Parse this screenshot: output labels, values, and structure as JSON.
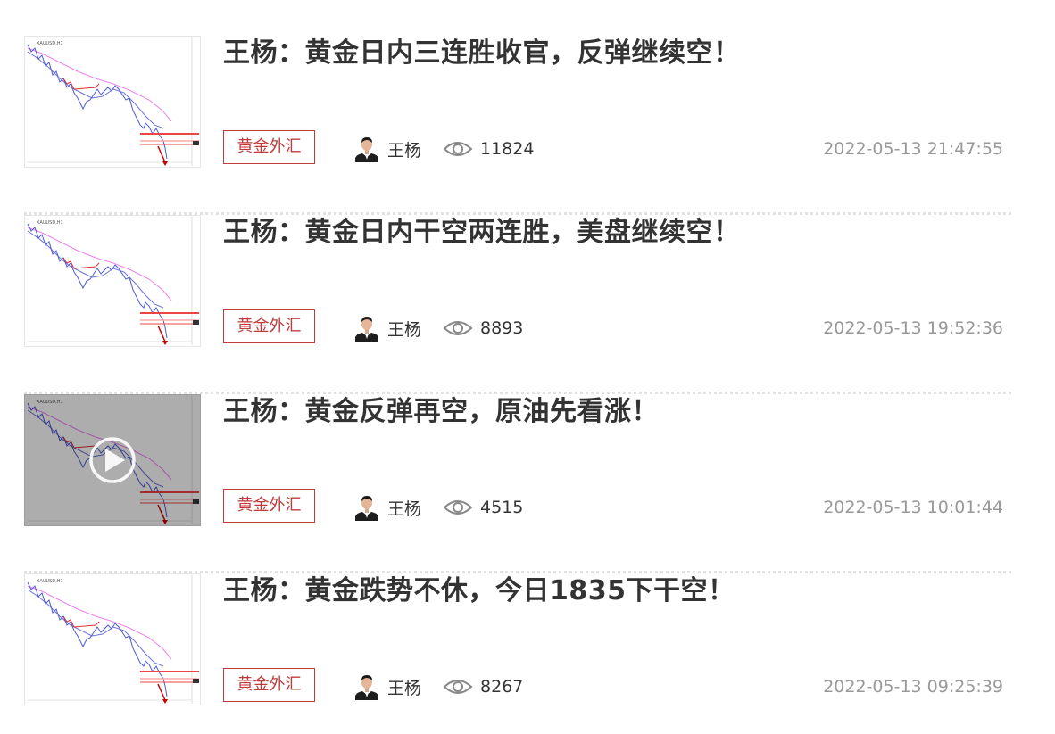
{
  "articles": [
    {
      "title": "王杨：黄金日内三连胜收官，反弹继续空！",
      "tag": "黄金外汇",
      "author": "王杨",
      "views": "11824",
      "time": "2022-05-13 21:47:55",
      "thumbnail_icon": "gold-chart-thumbnail",
      "is_video": false
    },
    {
      "title": "王杨：黄金日内干空两连胜，美盘继续空！",
      "tag": "黄金外汇",
      "author": "王杨",
      "views": "8893",
      "time": "2022-05-13 19:52:36",
      "thumbnail_icon": "gold-chart-thumbnail",
      "is_video": false
    },
    {
      "title": "王杨：黄金反弹再空，原油先看涨！",
      "tag": "黄金外汇",
      "author": "王杨",
      "views": "4515",
      "time": "2022-05-13 10:01:44",
      "thumbnail_icon": "gold-chart-thumbnail",
      "is_video": true
    },
    {
      "title": "王杨：黄金跌势不休，今日1835下干空！",
      "tag": "黄金外汇",
      "author": "王杨",
      "views": "8267",
      "time": "2022-05-13 09:25:39",
      "thumbnail_icon": "gold-chart-thumbnail",
      "is_video": false
    }
  ],
  "colors": {
    "title": "#333333",
    "tag": "#c23b3b",
    "time": "#999999",
    "divider": "#e2e2e2"
  }
}
